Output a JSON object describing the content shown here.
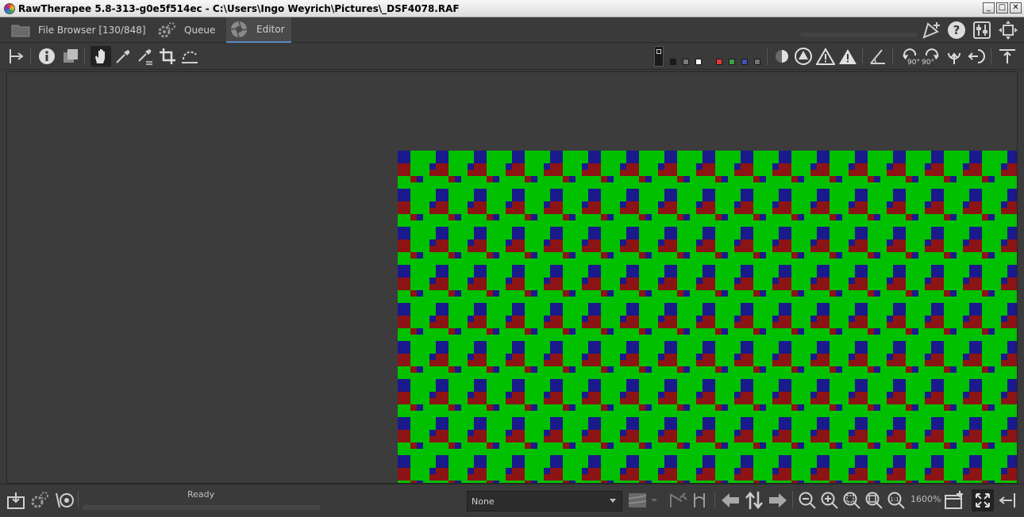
{
  "window": {
    "title": "RawTherapee 5.8-313-g0e5f514ec - C:\\Users\\Ingo Weyrich\\Pictures\\_DSF4078.RAF",
    "controls": {
      "minimize": "_",
      "maximize": "□",
      "close": "✕"
    }
  },
  "tabs": {
    "file_browser": "File Browser [130/848]",
    "queue": "Queue",
    "editor": "Editor"
  },
  "toolbar": {
    "swatch_colors": [
      "#1a1a1a",
      "#7a7a7a",
      "#ffffff",
      "#e53935",
      "#43a047",
      "#3f51b5",
      "#757575"
    ],
    "rotate_left_label": "90°",
    "rotate_right_label": "90°"
  },
  "canvas": {
    "mosaic_colors": {
      "green": "#00c000",
      "red": "#8c1414",
      "blue": "#1a1a8c"
    }
  },
  "statusbar": {
    "status_text": "Ready",
    "preview_mode": "None",
    "zoom_level": "1600%"
  },
  "icons": {
    "file_browser": "folder-icon",
    "queue": "gears-icon",
    "editor": "aperture-icon",
    "top_right": [
      "new-detail-window-icon",
      "help-icon",
      "preferences-icon",
      "fullscreen-icon"
    ],
    "toolbar_left": [
      "hide-history-icon",
      "info-icon",
      "before-after-icon",
      "hand-icon",
      "color-picker-icon",
      "white-balance-picker-icon",
      "crop-icon",
      "straighten-icon"
    ],
    "toolbar_right": [
      "focus-mask-icon",
      "shadows-clip-icon",
      "highlights-clip-icon",
      "warning-icon",
      "warning-filled-icon",
      "perspective-icon",
      "rotate-left-icon",
      "rotate-right-icon",
      "flip-vertical-icon",
      "flip-horizontal-icon",
      "hide-tools-icon"
    ],
    "bottom_left": [
      "save-icon",
      "queue-add-icon",
      "send-to-editor-icon"
    ],
    "bottom_right": [
      "preview-mode-icon",
      "navigate-prev-icon",
      "sync-icon",
      "navigate-next-icon",
      "zoom-out-icon",
      "zoom-in-icon",
      "zoom-fit-icon",
      "zoom-fill-icon",
      "zoom-100-icon",
      "new-window-icon",
      "fullscreen-icon",
      "collapse-icon"
    ]
  }
}
